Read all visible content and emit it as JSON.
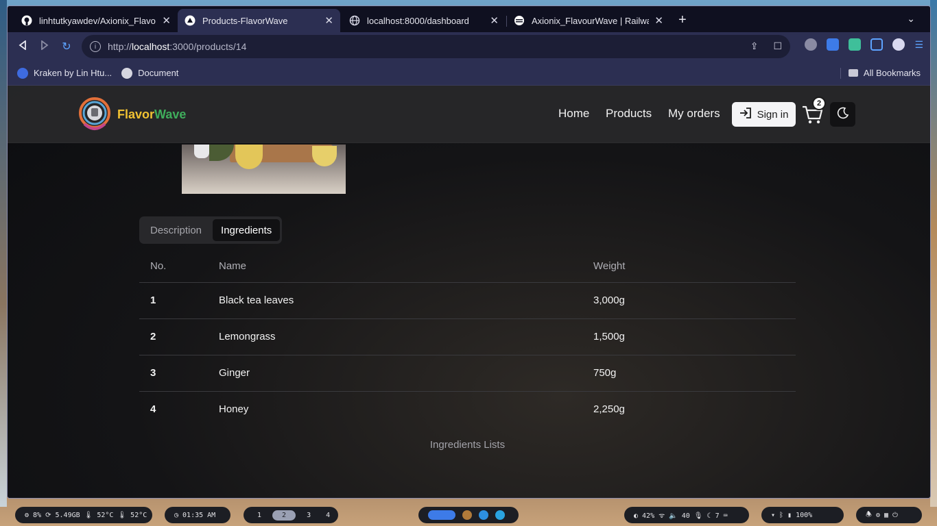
{
  "browser": {
    "tabs": [
      {
        "label": "linhtutkyawdev/Axionix_Flavo",
        "icon": "github-icon"
      },
      {
        "label": "Products-FlavorWave",
        "icon": "vercel-icon"
      },
      {
        "label": "localhost:8000/dashboard",
        "icon": "globe-icon"
      },
      {
        "label": "Axionix_FlavourWave | Railwa",
        "icon": "railway-icon"
      }
    ],
    "url_prefix": "http://",
    "url_host": "localhost",
    "url_rest": ":3000/products/14",
    "bookmarks": [
      {
        "label": "Kraken by Lin Htu...",
        "icon": "kraken-icon"
      },
      {
        "label": "Document",
        "icon": "globe-icon"
      }
    ],
    "all_bookmarks": "All Bookmarks"
  },
  "site": {
    "brand_part1": "Flavor",
    "brand_part2": "Wave",
    "nav": {
      "home": "Home",
      "products": "Products",
      "orders": "My orders"
    },
    "signin_label": "Sign in",
    "cart_count": "2"
  },
  "product": {
    "tabs": {
      "description": "Description",
      "ingredients": "Ingredients"
    },
    "table": {
      "headers": {
        "no": "No.",
        "name": "Name",
        "weight": "Weight"
      },
      "rows": [
        {
          "no": "1",
          "name": "Black tea leaves",
          "weight": "3,000g"
        },
        {
          "no": "2",
          "name": "Lemongrass",
          "weight": "1,500g"
        },
        {
          "no": "3",
          "name": "Ginger",
          "weight": "750g"
        },
        {
          "no": "4",
          "name": "Honey",
          "weight": "2,250g"
        }
      ],
      "caption": "Ingredients Lists"
    }
  },
  "taskbar": {
    "sysinfo": "⚙ 8% ⟳ 5.49GB 🌡 52°C 🌡 52°C",
    "clock": "◷ 01:35 AM",
    "workspaces": [
      "1",
      "2",
      "3",
      "4"
    ],
    "status": "◐ 42%  ᯤ  🔈 40 🎙 ☾ 7 ⌨",
    "battery": "▾  ᛒ  ▮ 100%"
  },
  "colors": {
    "brand_yellow": "#f1c232",
    "brand_green": "#3fae5c",
    "tab_active": "#2c2f52"
  }
}
